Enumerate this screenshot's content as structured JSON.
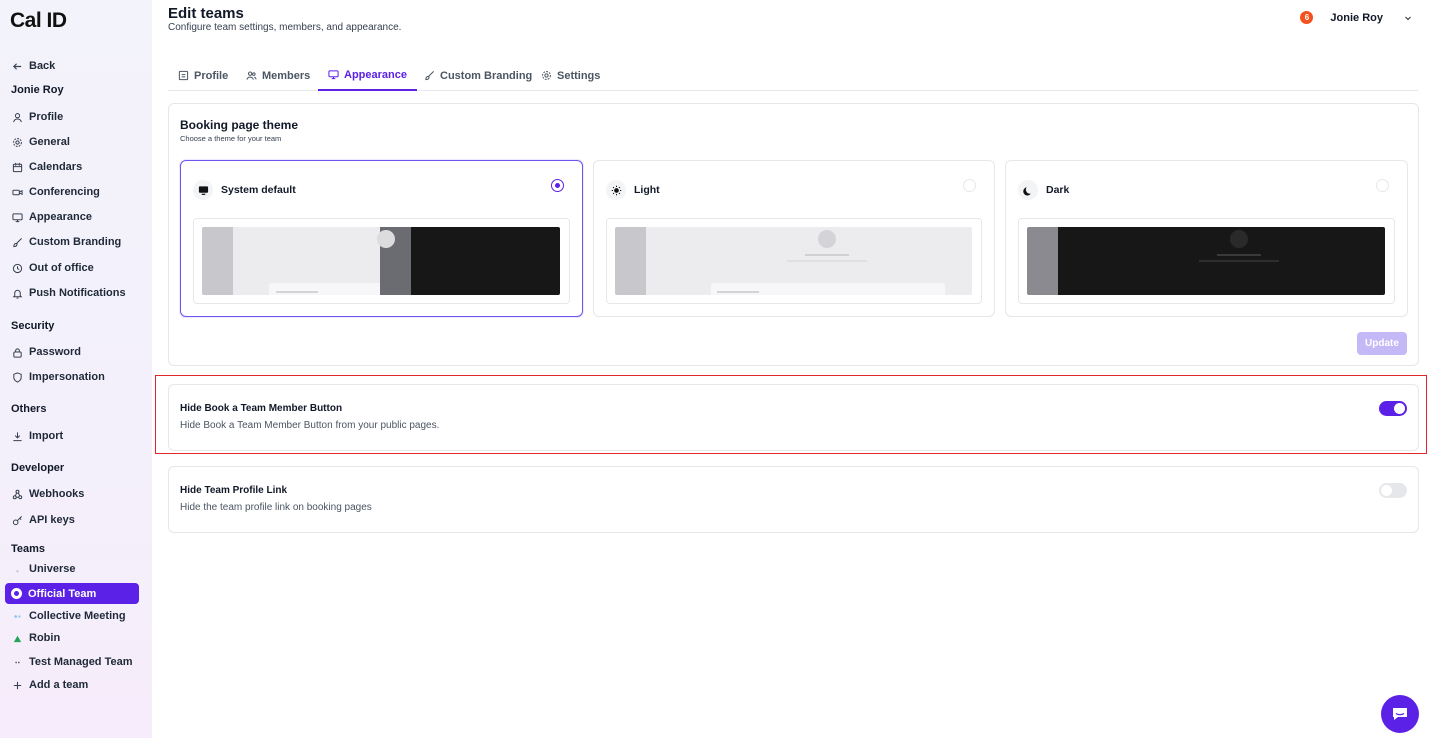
{
  "app": {
    "logo": "Cal ID"
  },
  "header": {
    "title": "Edit teams",
    "subtitle": "Configure team settings, members, and appearance."
  },
  "user": {
    "notification_count": "6",
    "name": "Jonie Roy"
  },
  "sidebar": {
    "back_label": "Back",
    "account_name": "Jonie Roy",
    "items": [
      {
        "label": "Profile",
        "icon": "user-icon"
      },
      {
        "label": "General",
        "icon": "gear-icon"
      },
      {
        "label": "Calendars",
        "icon": "calendar-icon"
      },
      {
        "label": "Conferencing",
        "icon": "video-icon"
      },
      {
        "label": "Appearance",
        "icon": "monitor-icon"
      },
      {
        "label": "Custom Branding",
        "icon": "brush-icon"
      },
      {
        "label": "Out of office",
        "icon": "clock-icon"
      },
      {
        "label": "Push Notifications",
        "icon": "bell-icon"
      }
    ],
    "security_title": "Security",
    "security_items": [
      {
        "label": "Password",
        "icon": "lock-icon"
      },
      {
        "label": "Impersonation",
        "icon": "shield-icon"
      }
    ],
    "others_title": "Others",
    "others_items": [
      {
        "label": "Import",
        "icon": "download-icon"
      }
    ],
    "developer_title": "Developer",
    "developer_items": [
      {
        "label": "Webhooks",
        "icon": "webhook-icon"
      },
      {
        "label": "API keys",
        "icon": "key-icon"
      }
    ],
    "teams_title": "Teams",
    "teams": [
      {
        "label": "Universe"
      },
      {
        "label": "Official Team",
        "active": true
      },
      {
        "label": "Collective Meeting"
      },
      {
        "label": "Robin"
      },
      {
        "label": "Test Managed Team"
      }
    ],
    "add_team_label": "Add a team"
  },
  "tabs": [
    {
      "label": "Profile",
      "icon": "profile-card-icon"
    },
    {
      "label": "Members",
      "icon": "users-icon"
    },
    {
      "label": "Appearance",
      "icon": "monitor-icon",
      "active": true
    },
    {
      "label": "Custom Branding",
      "icon": "brush-icon"
    },
    {
      "label": "Settings",
      "icon": "gear-icon"
    }
  ],
  "theme": {
    "title": "Booking page theme",
    "subtitle": "Choose a theme for your team",
    "options": [
      {
        "label": "System default",
        "icon": "monitor-icon",
        "selected": true
      },
      {
        "label": "Light",
        "icon": "sun-icon",
        "selected": false
      },
      {
        "label": "Dark",
        "icon": "moon-icon",
        "selected": false
      }
    ],
    "update_label": "Update"
  },
  "settings": {
    "hide_book_button": {
      "title": "Hide Book a Team Member Button",
      "description": "Hide Book a Team Member Button from your public pages.",
      "enabled": true
    },
    "hide_profile_link": {
      "title": "Hide Team Profile Link",
      "description": "Hide the team profile link on booking pages",
      "enabled": false
    }
  },
  "colors": {
    "accent": "#5b21e6",
    "highlight": "#e1262d",
    "badge": "#f4511e"
  }
}
